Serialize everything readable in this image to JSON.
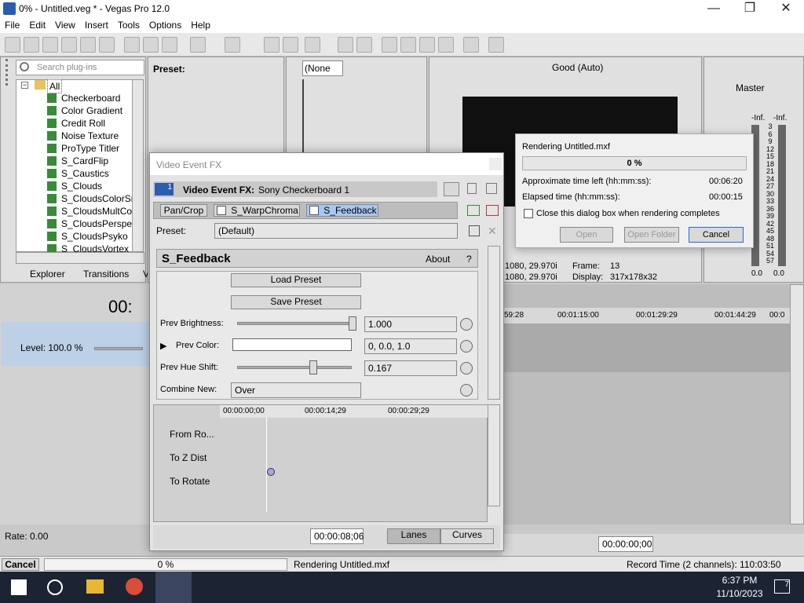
{
  "window": {
    "title": "0% - Untitled.veg * - Vegas Pro 12.0",
    "min": "—",
    "max": "❐",
    "close": "✕"
  },
  "menu": [
    "File",
    "Edit",
    "View",
    "Insert",
    "Tools",
    "Options",
    "Help"
  ],
  "plugins": {
    "search_placeholder": "Search plug-ins",
    "root": "All",
    "items": [
      "Checkerboard",
      "Color Gradient",
      "Credit Roll",
      "Noise Texture",
      "ProType Titler",
      "S_CardFlip",
      "S_Caustics",
      "S_Clouds",
      "S_CloudsColorSmo",
      "S_CloudsMultCol",
      "S_CloudsPerspect",
      "S_CloudsPsyko",
      "S_CloudsVortex"
    ],
    "tabs": [
      "Explorer",
      "Transitions",
      "V"
    ]
  },
  "preset_panel": {
    "label": "Preset:"
  },
  "trimmer": {
    "none": "(None"
  },
  "preview": {
    "quality": "Good (Auto)",
    "line1": "1080, 29.970i",
    "line2": "1080, 29.970i",
    "frame_label": "Frame:",
    "frame": "13",
    "display_label": "Display:",
    "display": "317x178x32"
  },
  "master": {
    "label": "Master",
    "inf_l": "-Inf.",
    "inf_r": "-Inf.",
    "val_l": "0.0",
    "val_r": "0.0",
    "ticks": [
      "3",
      "6",
      "9",
      "12",
      "15",
      "18",
      "21",
      "24",
      "27",
      "30",
      "33",
      "36",
      "39",
      "42",
      "45",
      "48",
      "51",
      "54",
      "57"
    ]
  },
  "track": {
    "time": "00:",
    "level": "Level: 100.0 %",
    "rate": "Rate: 0.00"
  },
  "timeline": {
    "marks": [
      "59:28",
      "00:01:15:00",
      "00:01:29:29",
      "00:01:44:29",
      "00:0"
    ],
    "cursor": "00:00:00;00"
  },
  "fx": {
    "title": "Video Event FX",
    "header": "Video Event FX:",
    "source": "Sony Checkerboard 1",
    "track_no": "1",
    "chain": [
      "Pan/Crop",
      "S_WarpChroma",
      "S_Feedback"
    ],
    "preset_label": "Preset:",
    "preset": "(Default)",
    "plugin": "S_Feedback",
    "about": "About",
    "help": "?",
    "load": "Load Preset",
    "save": "Save Preset",
    "params": [
      {
        "label": "Prev Brightness:",
        "value": "1.000",
        "pos": 1.0
      },
      {
        "label": "Prev Color:",
        "value": "0, 0.0, 1.0"
      },
      {
        "label": "Prev Hue Shift:",
        "value": "0.167",
        "pos": 0.65
      },
      {
        "label": "Combine New:",
        "value": "Over"
      }
    ],
    "kf_times": [
      "00:00:00;00",
      "00:00:14;29",
      "00:00:29;29"
    ],
    "lanes": [
      "From Ro...",
      "To Z Dist",
      "To Rotate"
    ],
    "time": "00:00:08;06",
    "lanes_btn": "Lanes",
    "curves_btn": "Curves"
  },
  "render": {
    "title": "Rendering Untitled.mxf",
    "percent": "0 %",
    "progress": 0,
    "left_label": "Approximate time left (hh:mm:ss):",
    "left": "00:06:20",
    "elapsed_label": "Elapsed time (hh:mm:ss):",
    "elapsed": "00:00:15",
    "close_label": "Close this dialog box when rendering completes",
    "open": "Open",
    "open_folder": "Open Folder",
    "cancel": "Cancel"
  },
  "status": {
    "cancel": "Cancel",
    "percent": "0 %",
    "message": "Rendering Untitled.mxf",
    "record": "Record Time (2 channels): 110:03:50"
  },
  "taskbar": {
    "time": "6:37 PM",
    "date": "11/10/2023",
    "notif": "7"
  }
}
